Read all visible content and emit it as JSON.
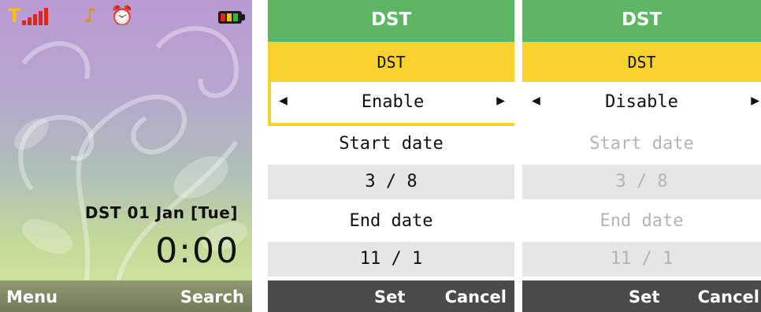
{
  "home": {
    "status_icons": [
      "signal-icon",
      "music-icon",
      "alarm-icon",
      "battery-icon"
    ],
    "date_line": "DST 01 Jan [Tue]",
    "time": "0:00",
    "softkeys": {
      "left": "Menu",
      "right": "Search"
    }
  },
  "dst_enable": {
    "title": "DST",
    "section": "DST",
    "selector_value": "Enable",
    "start_date_label": "Start date",
    "start_date_value": "3 / 8",
    "end_date_label": "End date",
    "end_date_value": "11 / 1",
    "softkeys": {
      "left": "Set",
      "right": "Cancel"
    }
  },
  "dst_disable": {
    "title": "DST",
    "section": "DST",
    "selector_value": "Disable",
    "start_date_label": "Start date",
    "start_date_value": "3 / 8",
    "end_date_label": "End date",
    "end_date_value": "11 / 1",
    "softkeys": {
      "left": "Set",
      "right": "Cancel"
    }
  },
  "colors": {
    "title_bar": "#5cb663",
    "highlight": "#f9d232",
    "softbar": "#4a4a4a",
    "value_row": "#e6e6e6",
    "disabled_text": "#b4b4b4"
  }
}
